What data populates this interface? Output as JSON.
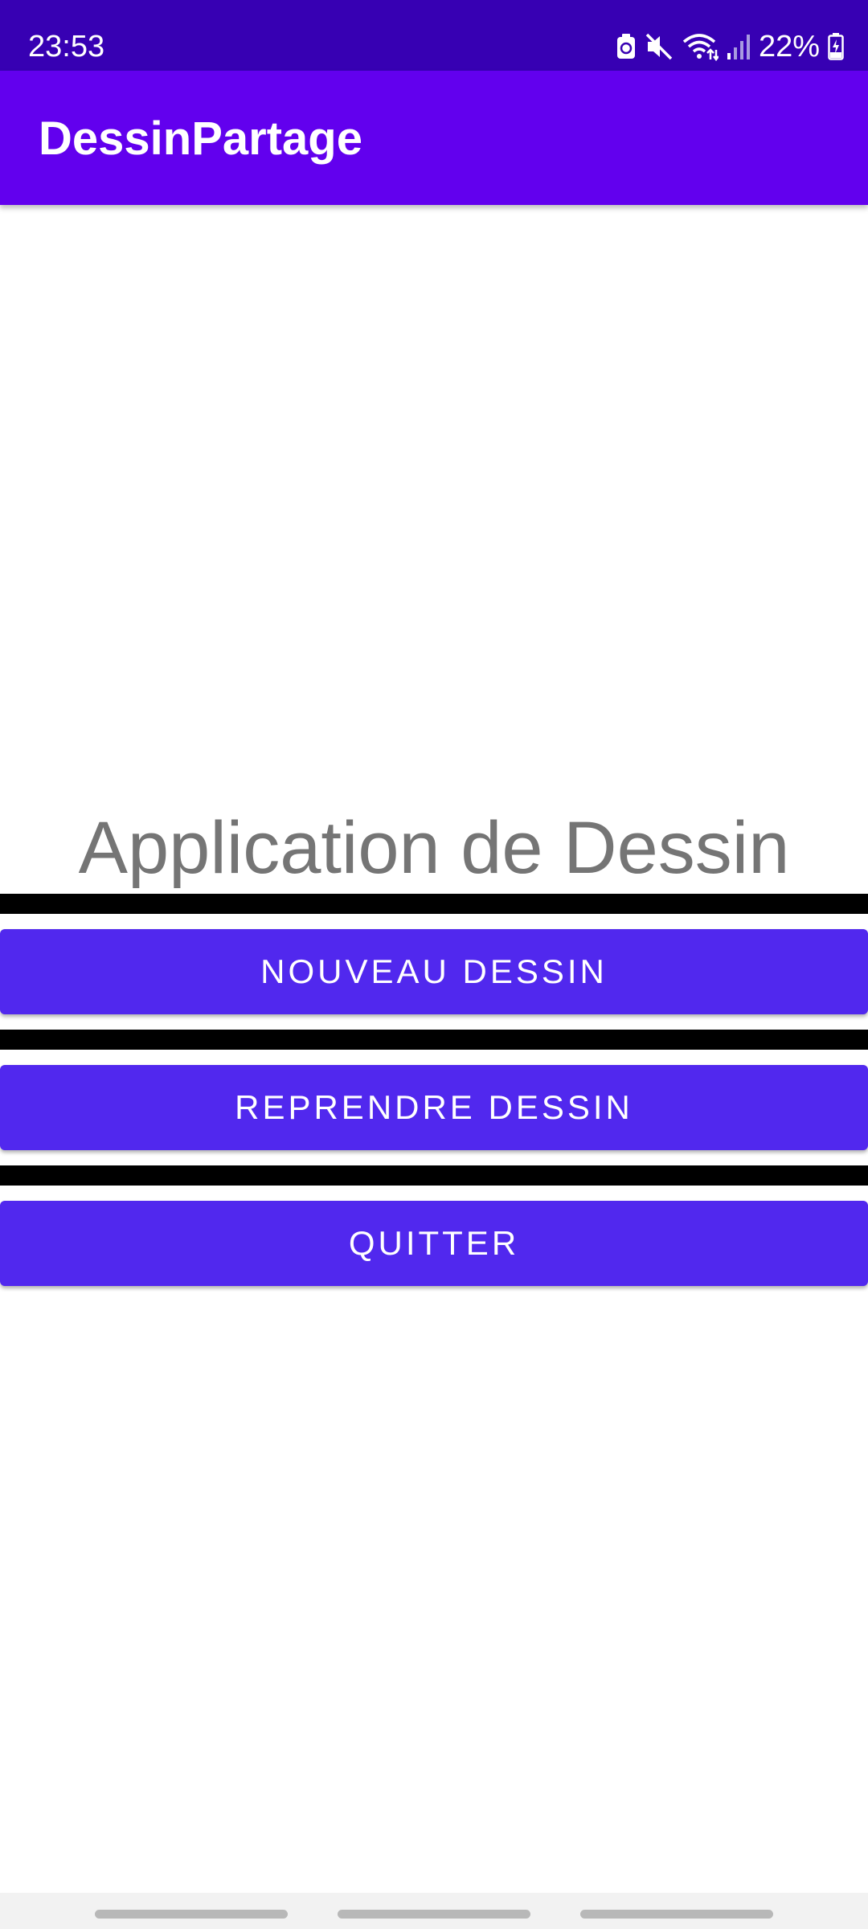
{
  "status_bar": {
    "time": "23:53",
    "battery": "22%",
    "icons": [
      "battery-saver-icon",
      "mute-icon",
      "wifi-icon",
      "signal-icon",
      "battery-icon"
    ],
    "background_color": "#3700b3"
  },
  "app_bar": {
    "title": "DessinPartage",
    "background_color": "#6200ee"
  },
  "main": {
    "heading": "Application de Dessin",
    "buttons": [
      {
        "label": "NOUVEAU DESSIN"
      },
      {
        "label": "REPRENDRE DESSIN"
      },
      {
        "label": "QUITTER"
      }
    ],
    "button_color": "#5128ee",
    "divider_color": "#000000"
  },
  "nav_bar": {
    "handles": [
      "recent-apps",
      "home",
      "back"
    ]
  }
}
